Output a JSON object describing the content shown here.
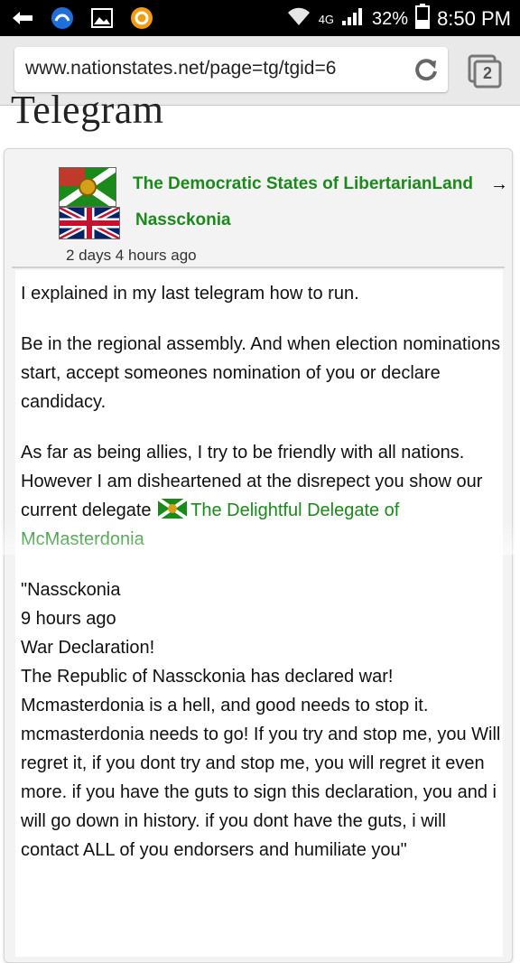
{
  "status_bar": {
    "network": "4G",
    "battery": "32%",
    "time": "8:50 PM",
    "icons": [
      "usb-icon",
      "voicemail-icon",
      "image-icon",
      "app-icon",
      "wifi-icon",
      "signal-icon",
      "battery-icon"
    ]
  },
  "browser": {
    "url": "www.nationstates.net/page=tg/tgid=6",
    "tab_count": "2"
  },
  "page": {
    "title_partial": "Telegram"
  },
  "telegram": {
    "from": "The Democratic States of LibertarianLand",
    "arrow": "→",
    "to": "Nassckonia",
    "time": "2 days 4 hours ago",
    "paragraphs": {
      "p1": "I explained in my last telegram how to run.",
      "p2": "Be in the regional assembly. And when election nominations start, accept someones nomination of you or declare candidacy.",
      "p3_prefix": "As far as being allies, I try to be friendly with all nations. However I am disheartened at the disrepect you show our current delegate",
      "p3_link": "The Delightful Delegate of McMasterdonia",
      "quote_line1": "\"Nassckonia",
      "quote_line2": "9 hours ago",
      "quote_line3": "War Declaration!",
      "quote_body": "The Republic of Nassckonia has declared war! Mcmasterdonia is a hell, and good needs to stop it. mcmasterdonia needs to go! If you try and stop me, you Will regret it, if you dont try and stop me, you will regret it even more. if you have the guts to sign this declaration, you and i will go down in history. if you dont have the guts, i will contact ALL of you endorsers and humiliate you\""
    }
  },
  "colors": {
    "link": "#1a8a1a",
    "status_bar": "#000000"
  }
}
